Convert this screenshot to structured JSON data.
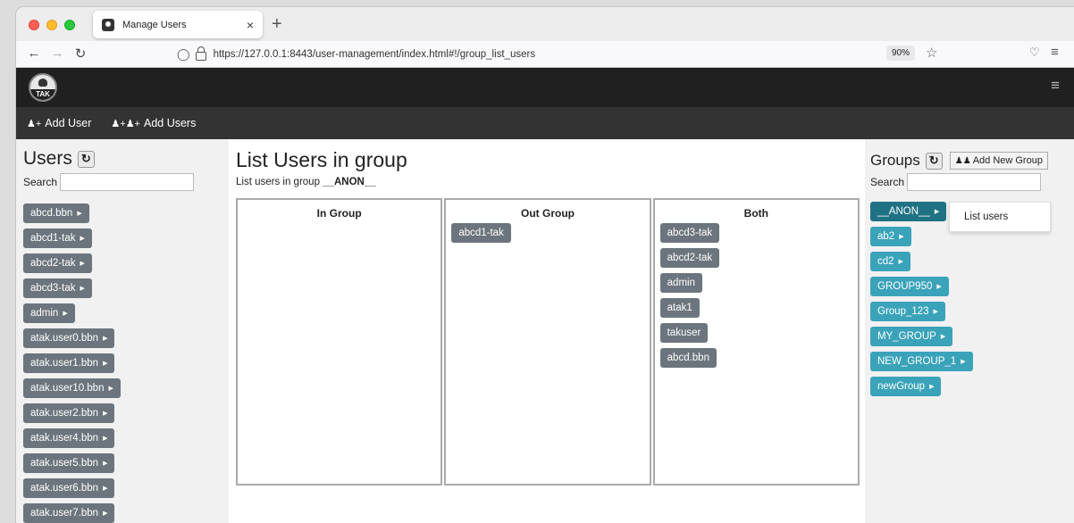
{
  "browser": {
    "tab_title": "Manage Users",
    "tab_close": "×",
    "new_tab": "+",
    "url": "https://127.0.0.1:8443/user-management/index.html#!/group_list_users",
    "zoom": "90%"
  },
  "app": {
    "logo_text": "TAK",
    "toolbar": {
      "add_user_label": "Add User",
      "add_users_label": "Add Users"
    }
  },
  "users_pane": {
    "title": "Users",
    "search_label": "Search",
    "search_value": "",
    "users": [
      "abcd.bbn",
      "abcd1-tak",
      "abcd2-tak",
      "abcd3-tak",
      "admin",
      "atak.user0.bbn",
      "atak.user1.bbn",
      "atak.user10.bbn",
      "atak.user2.bbn",
      "atak.user4.bbn",
      "atak.user5.bbn",
      "atak.user6.bbn",
      "atak.user7.bbn"
    ]
  },
  "main": {
    "title": "List Users in group",
    "subtitle_prefix": "List users in group",
    "group_name": "__ANON__",
    "columns": {
      "in_group": {
        "title": "In Group",
        "items": []
      },
      "out_group": {
        "title": "Out Group",
        "items": [
          "abcd1-tak"
        ]
      },
      "both": {
        "title": "Both",
        "items": [
          "abcd3-tak",
          "abcd2-tak",
          "admin",
          "atak1",
          "takuser",
          "abcd.bbn"
        ]
      }
    }
  },
  "groups_pane": {
    "title": "Groups",
    "add_button_label": "Add New Group",
    "search_label": "Search",
    "search_value": "",
    "groups": [
      "__ANON__",
      "ab2",
      "cd2",
      "GROUP950",
      "Group_123",
      "MY_GROUP",
      "NEW_GROUP_1",
      "newGroup"
    ],
    "dropdown_item": "List users"
  },
  "colors": {
    "user_pill": "#6c757d",
    "group_pill": "#3aa3ba",
    "group_active": "#1f7283",
    "header_bg": "#202020",
    "subbar_bg": "#333333"
  }
}
